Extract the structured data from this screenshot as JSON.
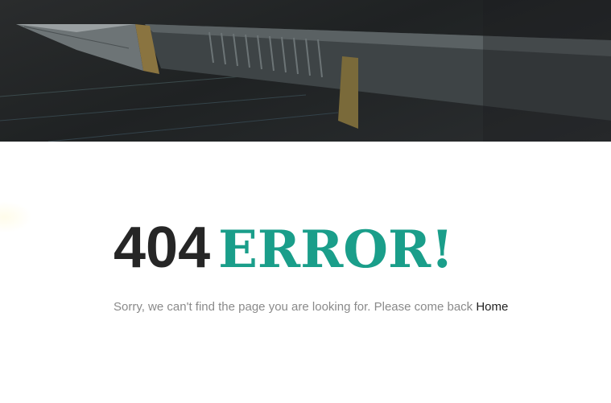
{
  "hero": {
    "image_subject": "fountain-pen-image"
  },
  "error": {
    "code": "404",
    "label": "ERROR!",
    "message": "Sorry, we can't find the page you are looking for. Please come back",
    "home_link": "Home"
  },
  "colors": {
    "accent": "#1a9e8a",
    "code_text": "#262626",
    "message_text": "#8a8a8a",
    "hero_bg": "#222526"
  }
}
